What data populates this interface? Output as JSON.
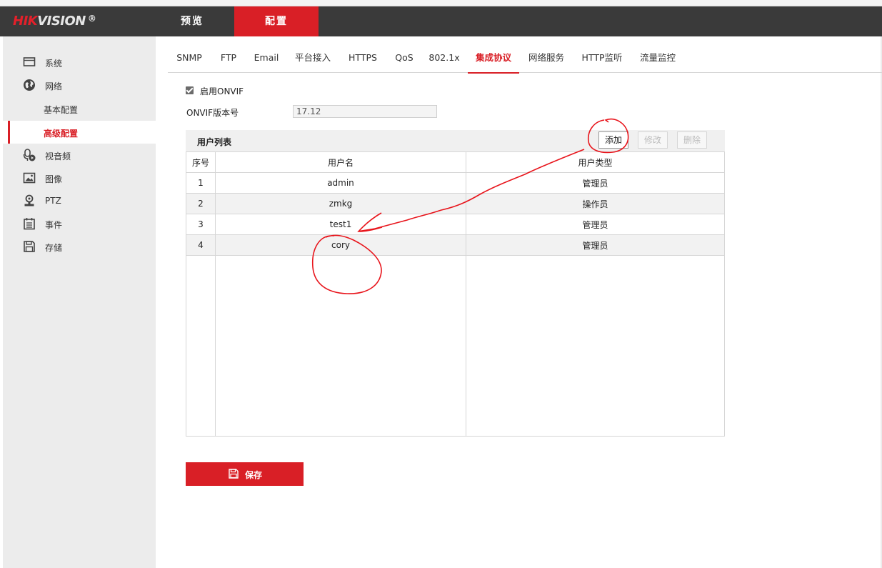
{
  "brand": {
    "part1": "HIK",
    "part2": "VISION",
    "reg": "®"
  },
  "topnav": [
    {
      "label": "预览",
      "active": false
    },
    {
      "label": "配置",
      "active": true
    }
  ],
  "sidebar": {
    "items": [
      {
        "label": "系统",
        "icon": "monitor-icon"
      },
      {
        "label": "网络",
        "icon": "globe-icon"
      },
      {
        "label": "基本配置",
        "sub": true
      },
      {
        "label": "高级配置",
        "sub": true,
        "active": true
      },
      {
        "label": "视音频",
        "icon": "microphone-play-icon"
      },
      {
        "label": "图像",
        "icon": "image-icon"
      },
      {
        "label": "PTZ",
        "icon": "ptz-camera-icon"
      },
      {
        "label": "事件",
        "icon": "calendar-icon"
      },
      {
        "label": "存储",
        "icon": "floppy-icon"
      }
    ]
  },
  "tabs": [
    "SNMP",
    "FTP",
    "Email",
    "平台接入",
    "HTTPS",
    "QoS",
    "802.1x",
    "集成协议",
    "网络服务",
    "HTTP监听",
    "流量监控"
  ],
  "active_tab": "集成协议",
  "onvif": {
    "enable_label": "启用ONVIF",
    "enabled": true,
    "version_label": "ONVIF版本号",
    "version_value": "17.12"
  },
  "user_list": {
    "title": "用户列表",
    "buttons": {
      "add": "添加",
      "edit": "修改",
      "delete": "删除"
    },
    "columns": [
      "序号",
      "用户名",
      "用户类型"
    ],
    "rows": [
      {
        "no": "1",
        "name": "admin",
        "type": "管理员"
      },
      {
        "no": "2",
        "name": "zmkg",
        "type": "操作员"
      },
      {
        "no": "3",
        "name": "test1",
        "type": "管理员"
      },
      {
        "no": "4",
        "name": "cory",
        "type": "管理员"
      }
    ]
  },
  "save_label": "保存",
  "colors": {
    "accent": "#d91f26",
    "topbar": "#3a3a3a",
    "sidebar": "#ececec",
    "annotation": "#e8141b"
  }
}
